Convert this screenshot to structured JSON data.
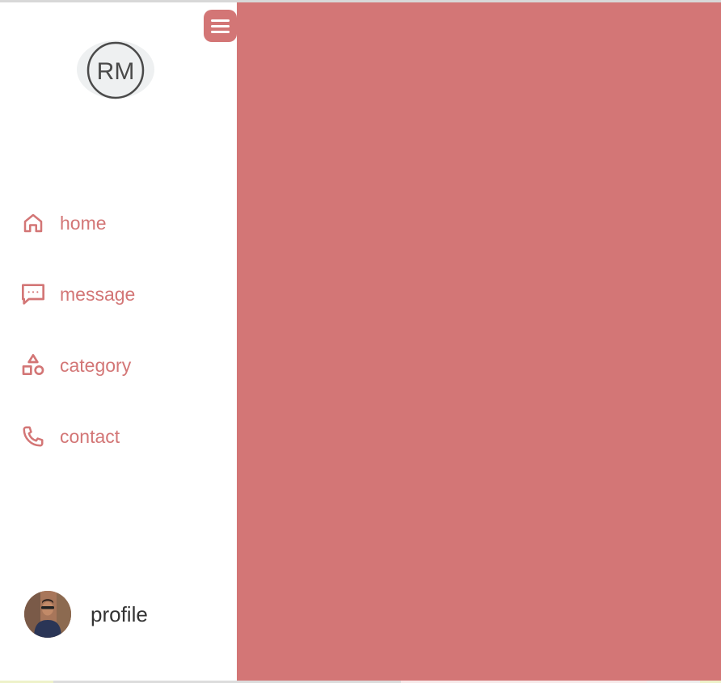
{
  "theme": {
    "accent": "#d37676"
  },
  "logo": {
    "text": "RM",
    "icon": "rm-monogram"
  },
  "menu_toggle": {
    "icon": "hamburger-icon"
  },
  "nav": {
    "items": [
      {
        "label": "home",
        "icon": "home-icon"
      },
      {
        "label": "message",
        "icon": "message-icon"
      },
      {
        "label": "category",
        "icon": "category-icon"
      },
      {
        "label": "contact",
        "icon": "phone-icon"
      }
    ]
  },
  "profile": {
    "label": "profile"
  }
}
